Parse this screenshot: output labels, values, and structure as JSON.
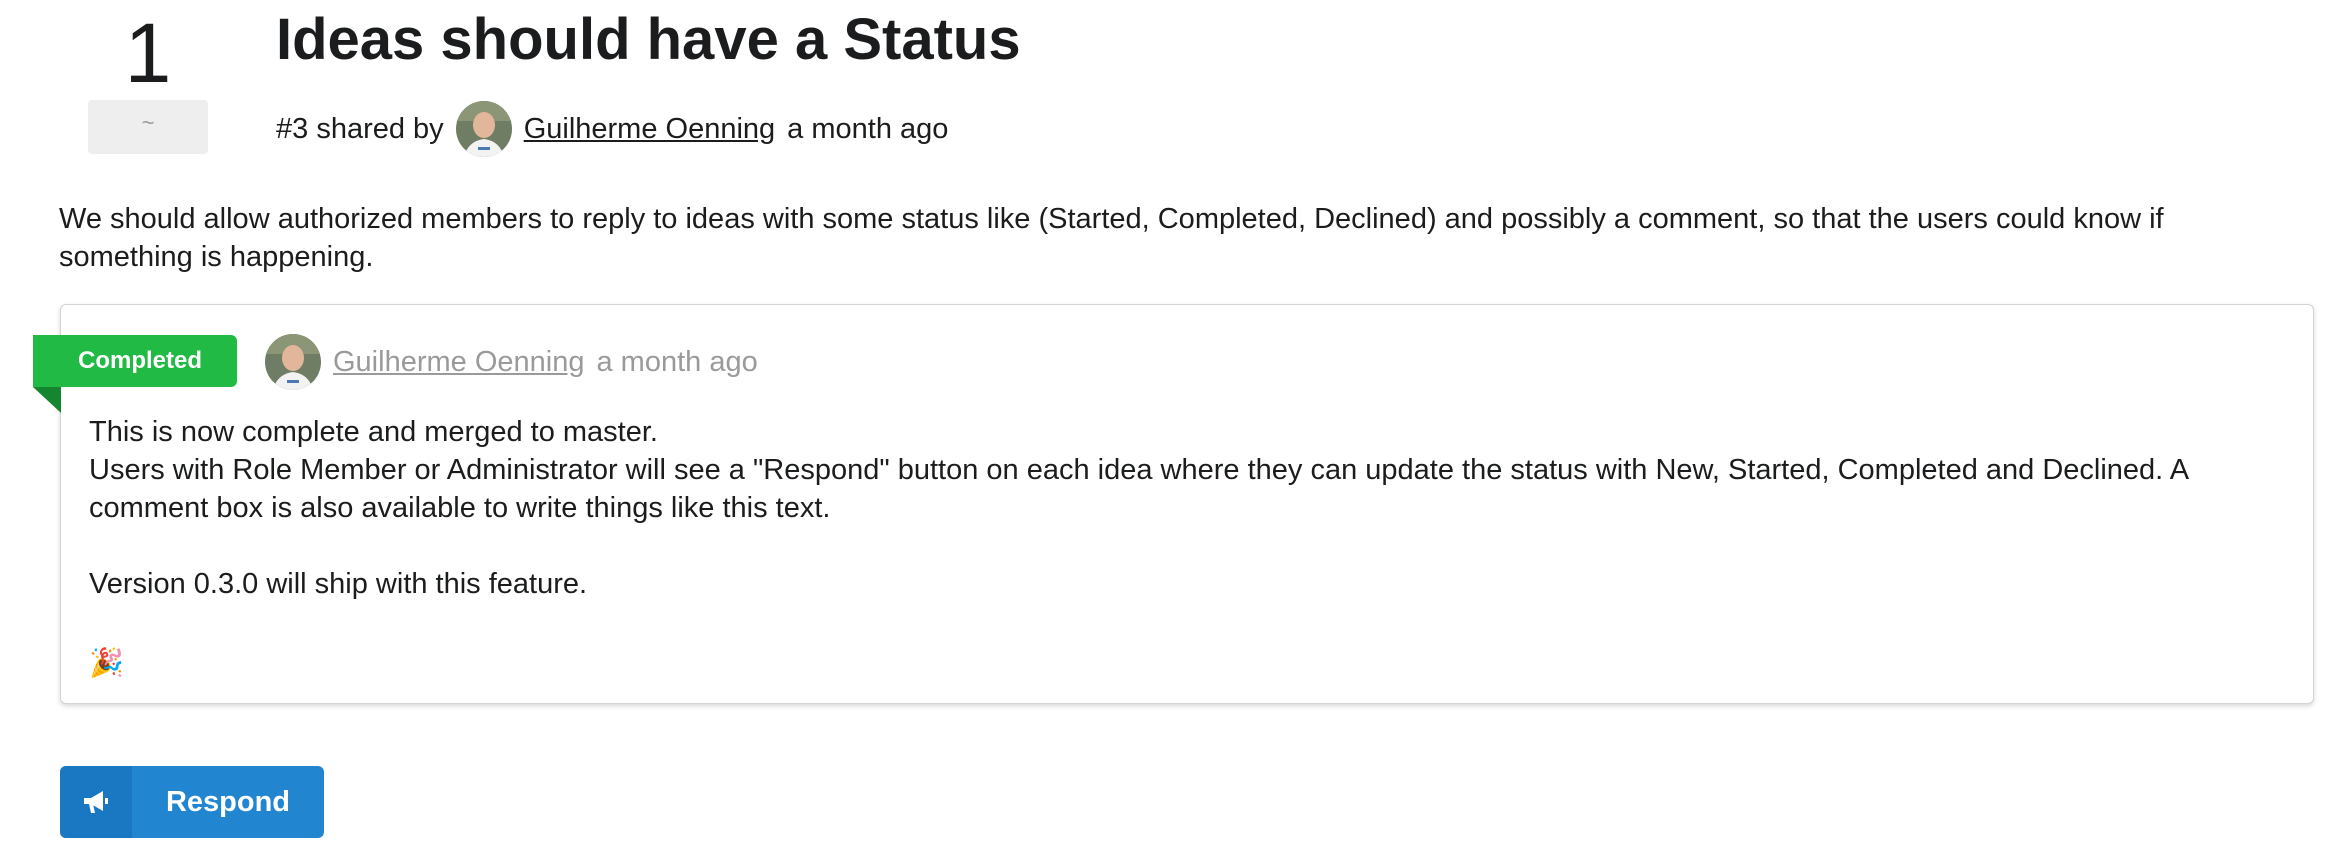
{
  "vote": {
    "count": "1",
    "button_label": "~"
  },
  "idea": {
    "title": "Ideas should have a Status",
    "number": "#3",
    "shared_by_text": "shared by",
    "author": "Guilherme Oenning",
    "time": "a month ago",
    "description": "We should allow authorized members to reply to ideas with some status like (Started, Completed, Declined) and possibly a comment, so that the users could know if something is happening."
  },
  "response": {
    "status": "Completed",
    "status_color": "#21ba45",
    "author": "Guilherme Oenning",
    "time": "a month ago",
    "lines": [
      "This is now complete and merged to master.",
      "Users with Role Member or Administrator will see a \"Respond\" button on each idea where they can update the status with New, Started, Completed and Declined. A comment box is also available to write things like this text.",
      "Version 0.3.0 will ship with this feature."
    ],
    "emoji": "🎉"
  },
  "actions": {
    "respond_label": "Respond",
    "respond_icon": "bullhorn-icon",
    "respond_color": "#2185d0"
  }
}
